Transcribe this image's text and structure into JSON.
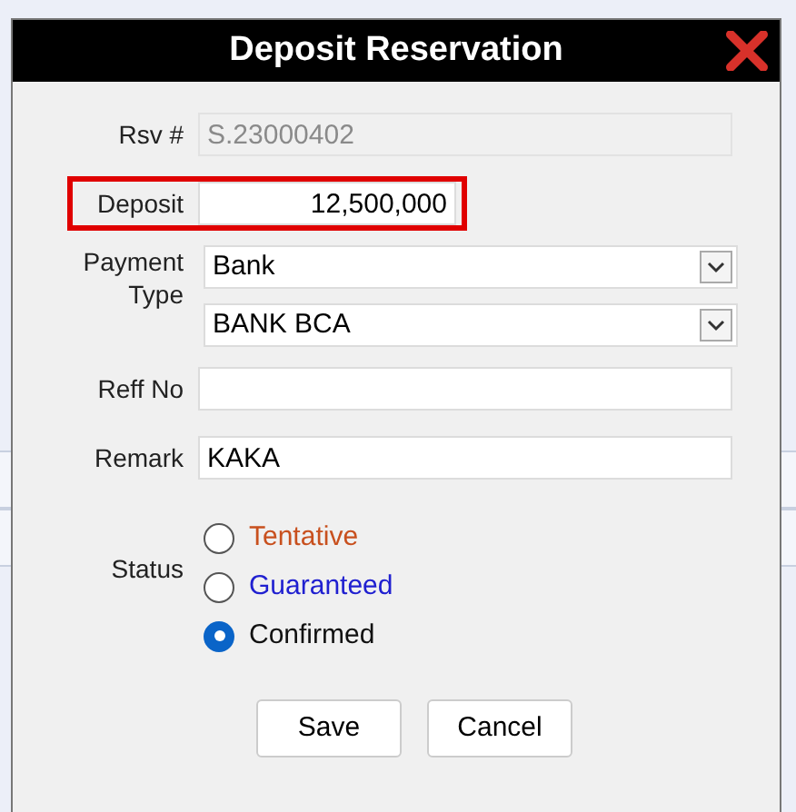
{
  "window": {
    "title": "Deposit Reservation"
  },
  "fields": [
    {
      "kind": "text",
      "label": "Rsv #",
      "value": "S.23000402",
      "disabled": true,
      "highlighted": false
    },
    {
      "kind": "amount",
      "label": "Deposit",
      "value": "12,500,000",
      "disabled": false,
      "highlighted": true
    },
    {
      "kind": "combo",
      "label": "Payment Type",
      "values": [
        "Bank",
        "BANK BCA"
      ]
    },
    {
      "kind": "text",
      "label": "Reff No",
      "disabled": false,
      "highlighted": false
    },
    {
      "kind": "text",
      "label": "Remark",
      "value": "KAKA",
      "disabled": false,
      "highlighted": false
    }
  ],
  "status": {
    "label": "Status",
    "options": [
      {
        "label": "Tentative",
        "color": "#c8501e",
        "selected": false
      },
      {
        "label": "Guaranteed",
        "color": "#2020d0",
        "selected": false
      },
      {
        "label": "Confirmed",
        "color": "#111111",
        "selected": true
      }
    ]
  },
  "buttons": [
    "Save",
    "Cancel"
  ]
}
